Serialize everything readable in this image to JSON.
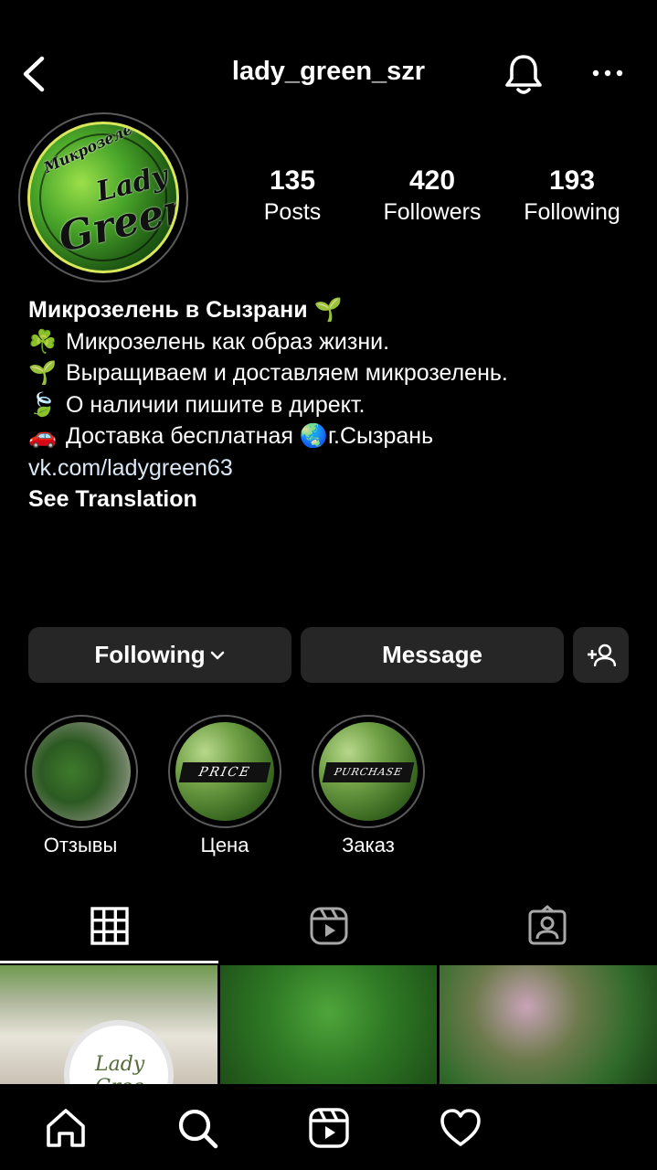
{
  "header": {
    "username": "lady_green_szr",
    "icons": [
      "back-chevron-icon",
      "bell-icon",
      "more-dots-icon"
    ]
  },
  "avatar": {
    "logo_line1": "Lady",
    "logo_line2": "Green",
    "logo_arc": "Микрозелень"
  },
  "stats": [
    {
      "value": "135",
      "label": "Posts"
    },
    {
      "value": "420",
      "label": "Followers"
    },
    {
      "value": "193",
      "label": "Following"
    }
  ],
  "bio": {
    "name": "Микрозелень в Сызрани",
    "name_emoji": "🌱",
    "lines": [
      {
        "emoji": "☘️",
        "text": "Микрозелень как образ жизни."
      },
      {
        "emoji": "🌱",
        "text": "Выращиваем и доставляем микрозелень."
      },
      {
        "emoji": "🍃",
        "text": "О наличии пишите в директ."
      },
      {
        "emoji": "🚗",
        "text": "Доставка бесплатная",
        "emoji2": "🌏",
        "text2": "г.Сызрань"
      }
    ],
    "link": "vk.com/ladygreen63",
    "see_translation": "See Translation"
  },
  "actions": {
    "following": "Following",
    "message": "Message"
  },
  "highlights": [
    {
      "label": "Отзывы",
      "tag": ""
    },
    {
      "label": "Цена",
      "tag": "PRICE"
    },
    {
      "label": "Заказ",
      "tag": "PURCHASE"
    }
  ],
  "tabs": [
    "grid-icon",
    "reels-icon",
    "tagged-icon"
  ],
  "grid": {
    "post1_label": "Lady Gree"
  },
  "bottom_nav": [
    "home-icon",
    "search-icon",
    "reels-icon",
    "heart-icon"
  ]
}
